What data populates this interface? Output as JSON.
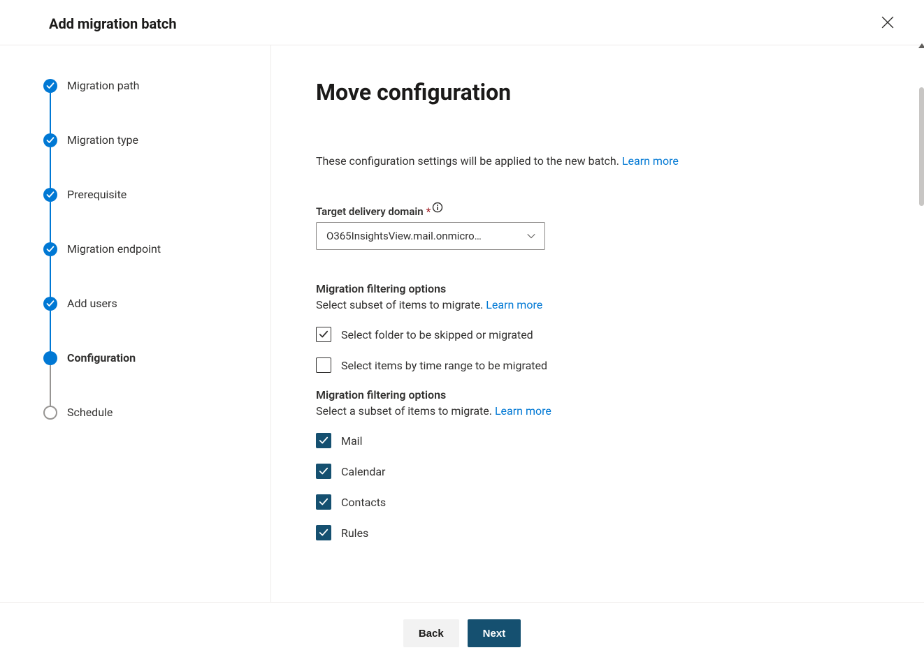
{
  "header": {
    "title": "Add migration batch"
  },
  "wizard": {
    "steps": [
      {
        "label": "Migration path",
        "state": "completed"
      },
      {
        "label": "Migration type",
        "state": "completed"
      },
      {
        "label": "Prerequisite",
        "state": "completed"
      },
      {
        "label": "Migration endpoint",
        "state": "completed"
      },
      {
        "label": "Add users",
        "state": "completed"
      },
      {
        "label": "Configuration",
        "state": "current"
      },
      {
        "label": "Schedule",
        "state": "pending"
      }
    ]
  },
  "main": {
    "heading": "Move configuration",
    "intro_text": "These configuration settings will be applied to the new batch. ",
    "learn_more": "Learn more",
    "target_domain": {
      "label": "Target delivery domain",
      "required": true,
      "selected": "O365InsightsView.mail.onmicro…"
    },
    "filtering1": {
      "title": "Migration filtering options",
      "subtitle": "Select subset of items to migrate. ",
      "learn_more": "Learn more",
      "options": [
        {
          "label": "Select folder to be skipped or migrated",
          "checked": true,
          "style": "outline"
        },
        {
          "label": "Select items by time range to be migrated",
          "checked": false,
          "style": "outline"
        }
      ]
    },
    "filtering2": {
      "title": "Migration filtering options",
      "subtitle": "Select a subset of items to migrate. ",
      "learn_more": "Learn more",
      "options": [
        {
          "label": "Mail",
          "checked": true,
          "style": "filled"
        },
        {
          "label": "Calendar",
          "checked": true,
          "style": "filled"
        },
        {
          "label": "Contacts",
          "checked": true,
          "style": "filled"
        },
        {
          "label": "Rules",
          "checked": true,
          "style": "filled"
        }
      ]
    }
  },
  "footer": {
    "back": "Back",
    "next": "Next"
  }
}
